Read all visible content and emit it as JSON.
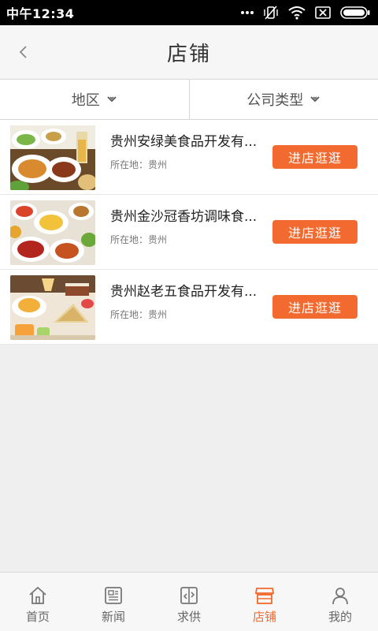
{
  "status_bar": {
    "time": "中午12:34",
    "icons": [
      "more-dots-icon",
      "vibrate-off-icon",
      "wifi-icon",
      "sim-off-icon",
      "battery-icon"
    ]
  },
  "header": {
    "title": "店铺",
    "back_icon": "chevron-left-icon"
  },
  "filters": [
    {
      "label": "地区",
      "icon": "chevron-down-icon"
    },
    {
      "label": "公司类型",
      "icon": "chevron-down-icon"
    }
  ],
  "shops": [
    {
      "name": "贵州安绿美食品开发有...",
      "location": "所在地：贵州",
      "button": "进店逛逛"
    },
    {
      "name": "贵州金沙冠香坊调味食...",
      "location": "所在地：贵州",
      "button": "进店逛逛"
    },
    {
      "name": "贵州赵老五食品开发有...",
      "location": "所在地：贵州",
      "button": "进店逛逛"
    }
  ],
  "tabs": [
    {
      "label": "首页",
      "icon": "home-icon",
      "active": false
    },
    {
      "label": "新闻",
      "icon": "news-icon",
      "active": false
    },
    {
      "label": "求供",
      "icon": "supply-icon",
      "active": false
    },
    {
      "label": "店铺",
      "icon": "shop-icon",
      "active": true
    },
    {
      "label": "我的",
      "icon": "user-icon",
      "active": false
    }
  ],
  "colors": {
    "accent": "#f26a2f",
    "status_bar": "#000000",
    "background": "#efefef"
  }
}
